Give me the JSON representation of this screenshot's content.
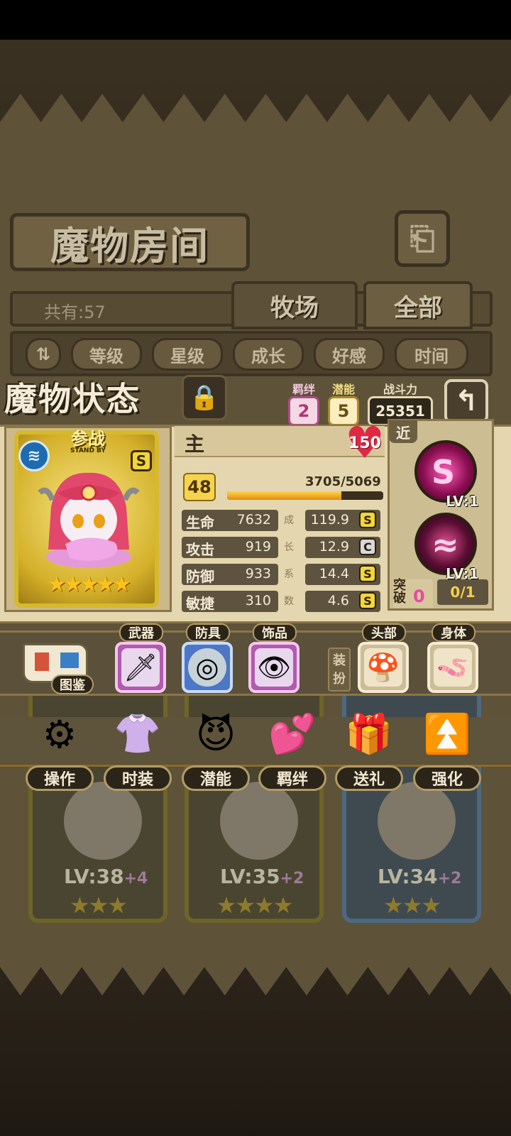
{
  "room": {
    "title": "魔物房间",
    "total_label": "共有:57",
    "tabs": [
      "牧场",
      "全部"
    ],
    "sort_buttons": [
      "等级",
      "星级",
      "成长",
      "好感",
      "时间"
    ]
  },
  "grid": {
    "cards": [
      {
        "level": "LV:38",
        "bonus": "+4",
        "stars": "★★★",
        "frame": "gold"
      },
      {
        "level": "LV:35",
        "bonus": "+2",
        "stars": "★★★★",
        "frame": "gold"
      },
      {
        "level": "LV:34",
        "bonus": "+2",
        "stars": "★★★",
        "frame": "blue"
      }
    ],
    "actions": [
      {
        "label": "操作",
        "icon": "gear-icon",
        "glyph": "⚙"
      },
      {
        "label": "时装",
        "icon": "outfit-icon",
        "glyph": "👚"
      },
      {
        "label": "潜能",
        "icon": "potential-icon",
        "glyph": "😈"
      },
      {
        "label": "羁绊",
        "icon": "bond-hearts-icon",
        "glyph": "💕"
      },
      {
        "label": "送礼",
        "icon": "gift-icon",
        "glyph": "🎁"
      },
      {
        "label": "强化",
        "icon": "upgrade-arrows-icon",
        "glyph": "⏫"
      }
    ]
  },
  "status": {
    "title": "魔物状态",
    "bond_label": "羁绊",
    "bond_value": "2",
    "potential_label": "潜能",
    "potential_value": "5",
    "power_label": "战斗力",
    "power_value": "25351",
    "standby_label": "参战",
    "standby_sub": "STAND BY",
    "rank": "S",
    "card_stars": "★★★★★",
    "name": "主",
    "affection": "150",
    "level": "48",
    "exp_text": "3705/5069",
    "exp_fraction": 0.731,
    "stats": [
      {
        "label": "生命",
        "value": "7632",
        "growth": "119.9",
        "grade": "S"
      },
      {
        "label": "攻击",
        "value": "919",
        "growth": "12.9",
        "grade": "C"
      },
      {
        "label": "防御",
        "value": "933",
        "growth": "14.4",
        "grade": "S"
      },
      {
        "label": "敏捷",
        "value": "310",
        "growth": "4.6",
        "grade": "S"
      }
    ],
    "growth_chars": [
      "成",
      "长",
      "系",
      "数"
    ],
    "range_label": "近",
    "skills": [
      {
        "level": "LV:1"
      },
      {
        "level": "LV:1"
      }
    ],
    "break_label": "突破",
    "break_value": "0",
    "break_count": "0/1"
  },
  "equipment": {
    "codex_label": "图鉴",
    "weapon_label": "武器",
    "armor_label": "防具",
    "accessory_label": "饰品",
    "dress_label": "装扮",
    "head_label": "头部",
    "body_label": "身体"
  },
  "colors": {
    "parchment": "#e4d6ae",
    "accent_gold": "#f2d63a",
    "heart_red": "#e02844",
    "skill_magenta": "#ff5fb9"
  }
}
